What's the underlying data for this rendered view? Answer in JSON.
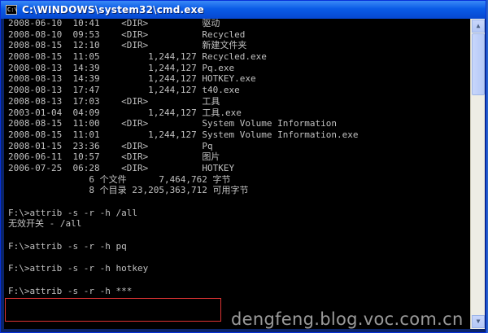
{
  "window": {
    "title": "C:\\WINDOWS\\system32\\cmd.exe",
    "icon": "cmd-icon"
  },
  "console": {
    "lines": [
      "2008-06-10  10:41    <DIR>          驱动",
      "2008-08-10  09:53    <DIR>          Recycled",
      "2008-08-15  12:10    <DIR>          新建文件夹",
      "2008-08-15  11:05         1,244,127 Recycled.exe",
      "2008-08-13  14:39         1,244,127 Pq.exe",
      "2008-08-13  14:39         1,244,127 HOTKEY.exe",
      "2008-08-13  17:47         1,244,127 t40.exe",
      "2008-08-13  17:03    <DIR>          工具",
      "2003-01-04  04:09         1,244,127 工具.exe",
      "2008-08-15  11:00    <DIR>          System Volume Information",
      "2008-08-15  11:01         1,244,127 System Volume Information.exe",
      "2008-01-15  23:36    <DIR>          Pq",
      "2006-06-11  10:57    <DIR>          图片",
      "2006-07-25  06:28    <DIR>          HOTKEY",
      "               6 个文件      7,464,762 字节",
      "               8 个目录 23,205,363,712 可用字节",
      "",
      "F:\\>attrib -s -r -h /all",
      "无效开关 - /all",
      "",
      "F:\\>attrib -s -r -h pq",
      "",
      "F:\\>attrib -s -r -h hotkey",
      "",
      "F:\\>attrib -s -r -h ***"
    ]
  },
  "watermark": "dengfeng.blog.voc.com.cn",
  "colors": {
    "console_bg": "#000000",
    "console_text": "#c0c0c0",
    "titlebar": "#0a5be6",
    "highlight": "#dd3333"
  }
}
